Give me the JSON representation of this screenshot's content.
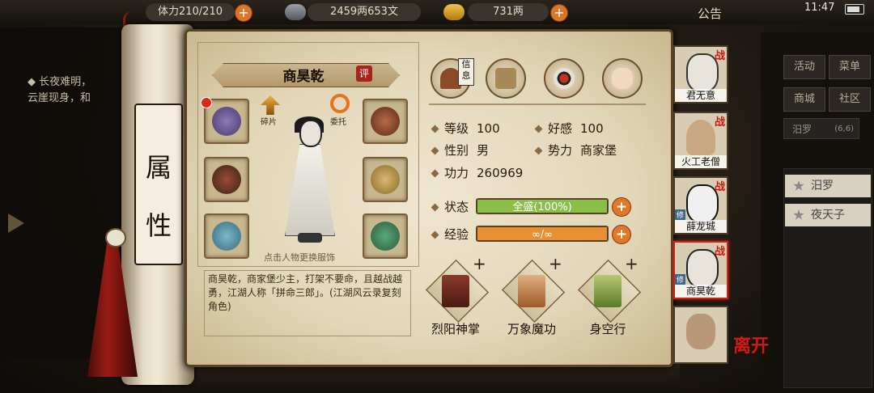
{
  "topbar": {
    "stamina": "体力210/210",
    "copper": "2459两653文",
    "gold": "731两",
    "notice": "公告",
    "clock": "11:47"
  },
  "left_panel": {
    "quest_title": "长夜难明，",
    "quest_line2": "云崖现身，和"
  },
  "side_tab": {
    "char1": "属",
    "char2": "性"
  },
  "character": {
    "name": "商昊乾",
    "rate": "评",
    "fragment_label": "碎片",
    "entrust_label": "委托",
    "figure_hint": "点击人物更换服饰",
    "description": "商昊乾，商家堡少主，打架不要命，且越战越勇，江湖人称「拼命三郎」。(江湖风云录复刻角色)"
  },
  "tabs": {
    "info_tag": "信息",
    "icons": [
      "info-hat-icon",
      "scroll-box-icon",
      "bagua-icon",
      "body-meridian-icon"
    ]
  },
  "stats": {
    "level_label": "等级",
    "level": "100",
    "affinity_label": "好感",
    "affinity": "100",
    "gender_label": "性别",
    "gender": "男",
    "faction_label": "势力",
    "faction": "商家堡",
    "power_label": "功力",
    "power": "260969"
  },
  "status": {
    "label": "状态",
    "text": "全盛(100%)",
    "fill_percent": 100,
    "color": "#8ac04a"
  },
  "exp": {
    "label": "经验",
    "text": "∞/∞",
    "fill_percent": 100,
    "color": "#e89030"
  },
  "skills": [
    {
      "name": "烈阳神掌",
      "icon": "palm-book-icon"
    },
    {
      "name": "万象魔功",
      "icon": "scroll-icon"
    },
    {
      "name": "身空行",
      "icon": "jade-scroll-icon"
    }
  ],
  "roster": [
    {
      "name": "君无意",
      "battle": "战"
    },
    {
      "name": "火工老僧",
      "battle": "战"
    },
    {
      "name": "薛龙城",
      "battle": "战",
      "tag": "修"
    },
    {
      "name": "商昊乾",
      "battle": "战",
      "tag": "修"
    },
    {
      "name": "",
      "battle": ""
    }
  ],
  "leave": "离开",
  "right_menu": {
    "activity": "活动",
    "menu": "菜单",
    "shop": "商城",
    "community": "社区",
    "location": "汨罗",
    "coords": "(6,6)",
    "sub1": "汨罗",
    "sub2": "夜天子"
  }
}
